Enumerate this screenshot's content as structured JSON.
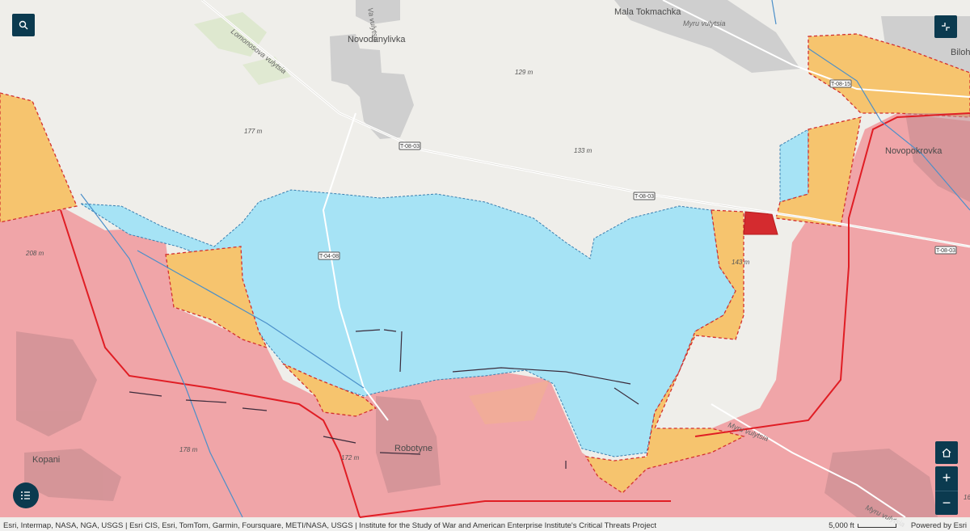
{
  "map": {
    "places": [
      {
        "name": "Novodanylivka",
        "kind": "town"
      },
      {
        "name": "Mala Tokmachka",
        "kind": "town"
      },
      {
        "name": "Bilohi",
        "kind": "town"
      },
      {
        "name": "Novopokrovka",
        "kind": "town"
      },
      {
        "name": "Robotyne",
        "kind": "town"
      },
      {
        "name": "Kopani",
        "kind": "town"
      }
    ],
    "elevations": [
      "129 m",
      "177 m",
      "133 m",
      "208 m",
      "143 m",
      "178 m",
      "172 m",
      "16"
    ],
    "roads": {
      "lomonosova": "Lomonosova vulytsia",
      "myru": "Myru vulytsia",
      "varvulytsia": "Va vulytsia",
      "myrunorth": "Myru vulytsia",
      "myru_ne": "Myru vulytsia",
      "myru_se": "Myru vulytsia"
    },
    "shields": [
      "T-08-03",
      "T-08-03",
      "T-08-15",
      "T-04-08",
      "T-08-03"
    ],
    "colors": {
      "red_zone": "#f0a5a8",
      "blue_zone": "#a6e3f5",
      "orange_zone": "#f6c46e",
      "dark_red": "#d42b2f",
      "base": "#efeeea"
    }
  },
  "controls": {
    "search_icon": "search-icon",
    "collapse_icon": "collapse-icon",
    "home_icon": "home-icon",
    "zoom_in": "+",
    "zoom_out": "−",
    "legend_icon": "legend-icon"
  },
  "attribution": {
    "sources": "Esri, Intermap, NASA, NGA, USGS | Esri CIS, Esri, TomTom, Garmin, Foursquare, METI/NASA, USGS | Institute for the Study of War and American Enterprise Institute's Critical Threats Project",
    "scale_label": "5,000 ft",
    "powered": "Powered by Esri"
  }
}
